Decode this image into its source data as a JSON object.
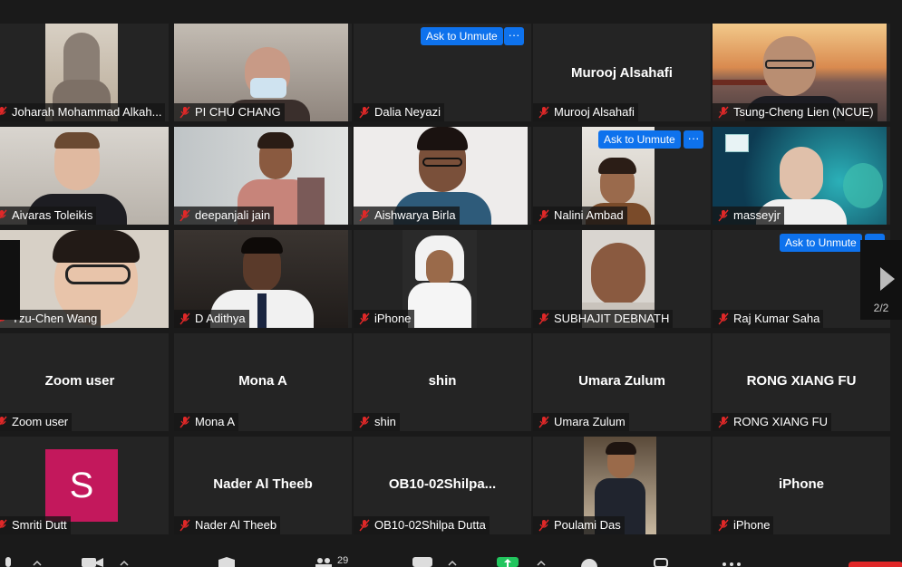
{
  "meeting": {
    "ask_to_unmute_label": "Ask to Unmute",
    "more_label": "···",
    "page_indicator": "2/2",
    "participant_count": "29",
    "accent_color": "#0e72ed",
    "muted_icon_color": "#e02828"
  },
  "tiles": [
    {
      "name": "Joharah Mohammad Alkah...",
      "display": "video"
    },
    {
      "name": "PI CHU CHANG",
      "display": "video"
    },
    {
      "name": "Dalia Neyazi",
      "display": "blank"
    },
    {
      "name": "Murooj Alsahafi",
      "center": "Murooj Alsahafi",
      "display": "name"
    },
    {
      "name": "Tsung-Cheng Lien (NCUE)",
      "display": "video"
    },
    {
      "name": "Aivaras Toleikis",
      "display": "video"
    },
    {
      "name": "deepanjali jain",
      "display": "video"
    },
    {
      "name": "Aishwarya Birla",
      "display": "video"
    },
    {
      "name": "Nalini Ambad",
      "display": "video"
    },
    {
      "name": "masseyjr",
      "display": "video"
    },
    {
      "name": "Tzu-Chen Wang",
      "display": "video"
    },
    {
      "name": "D Adithya",
      "display": "video"
    },
    {
      "name": "iPhone",
      "display": "video"
    },
    {
      "name": "SUBHAJIT DEBNATH",
      "display": "video"
    },
    {
      "name": "Raj Kumar Saha",
      "display": "blank"
    },
    {
      "name": "Zoom user",
      "center": "Zoom user",
      "display": "name"
    },
    {
      "name": "Mona A",
      "center": "Mona A",
      "display": "name"
    },
    {
      "name": "shin",
      "center": "shin",
      "display": "name"
    },
    {
      "name": "Umara Zulum",
      "center": "Umara Zulum",
      "display": "name"
    },
    {
      "name": "RONG XIANG FU",
      "center": "RONG XIANG FU",
      "display": "name"
    },
    {
      "name": "Smriti Dutt",
      "avatar_letter": "S",
      "display": "avatar"
    },
    {
      "name": "Nader Al Theeb",
      "center": "Nader Al Theeb",
      "display": "name"
    },
    {
      "name": "OB10-02Shilpa Dutta",
      "center": "OB10-02Shilpa...",
      "display": "name"
    },
    {
      "name": "Poulami Das",
      "display": "video"
    },
    {
      "name": "iPhone",
      "center": "iPhone",
      "display": "name"
    }
  ]
}
